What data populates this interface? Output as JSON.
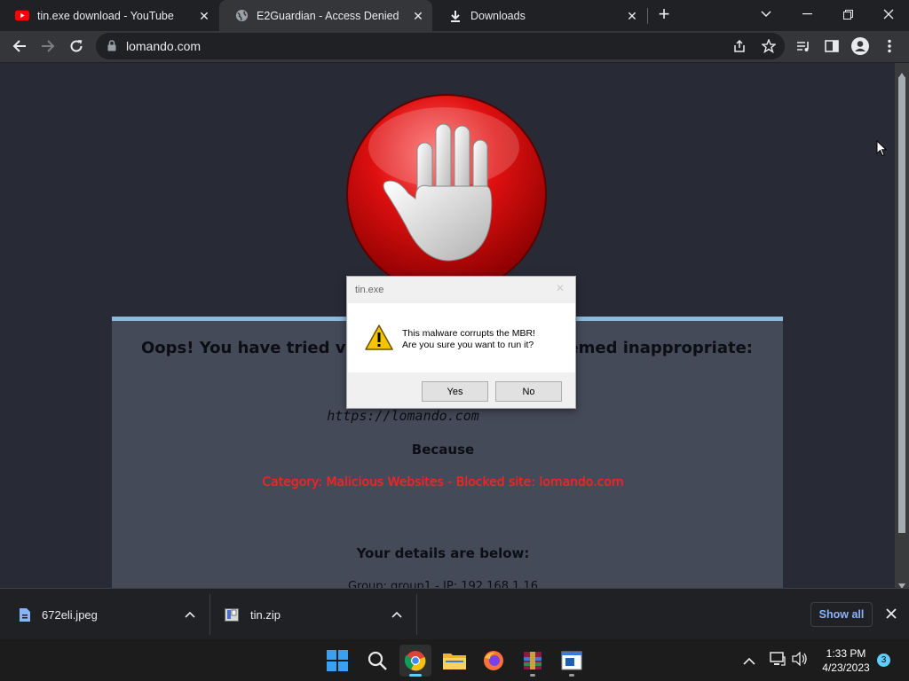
{
  "tabs": [
    {
      "title": "tin.exe download - YouTube",
      "favicon": "youtube-icon"
    },
    {
      "title": "E2Guardian - Access Denied",
      "favicon": "globe-icon",
      "active": true
    },
    {
      "title": "Downloads",
      "favicon": "download-icon"
    }
  ],
  "toolbar": {
    "url": "lomando.com"
  },
  "page": {
    "heading_left": "Oops! You have tried visiti",
    "heading_right": "deemed inappropriate:",
    "blocked_url": "https://lomando.com",
    "because": "Because",
    "reason": "Category: Malicious Websites - Blocked site: lomando.com",
    "details": "Your details are below:",
    "details_partial": "Group: group1 - IP: 192.168.1.16"
  },
  "dialog": {
    "title": "tin.exe",
    "message_line1": "This malware corrupts the MBR!",
    "message_line2": "Are you sure you want to run it?",
    "yes_label": "Yes",
    "no_label": "No"
  },
  "downloads": {
    "items": [
      {
        "name": "672eli.jpeg",
        "icon": "image-file-icon"
      },
      {
        "name": "tin.zip",
        "icon": "zip-file-icon"
      }
    ],
    "show_all": "Show all"
  },
  "taskbar": {
    "time": "1:33 PM",
    "date": "4/23/2023",
    "notification_count": "3"
  },
  "colors": {
    "accent_blue": "#8ab4f8",
    "reason_red": "#ff2020",
    "card_bg": "#454a59"
  }
}
